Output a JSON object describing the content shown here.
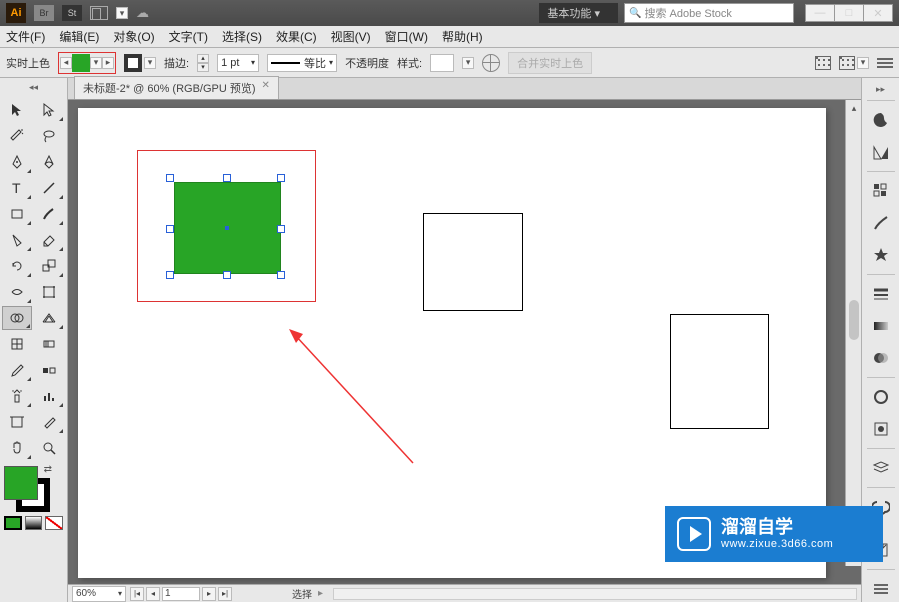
{
  "titlebar": {
    "workspace_label": "基本功能",
    "search_placeholder": "搜索 Adobe Stock"
  },
  "menu": {
    "file": "文件(F)",
    "edit": "编辑(E)",
    "object": "对象(O)",
    "text": "文字(T)",
    "select": "选择(S)",
    "effect": "效果(C)",
    "view": "视图(V)",
    "window": "窗口(W)",
    "help": "帮助(H)"
  },
  "options": {
    "label": "实时上色",
    "stroke_label": "描边:",
    "stroke_width": "1 pt",
    "proportional": "等比",
    "opacity_label": "不透明度",
    "style_label": "样式:",
    "merge_btn": "合并实时上色"
  },
  "doc": {
    "tab_title": "未标题-2* @ 60% (RGB/GPU 预览)"
  },
  "status": {
    "zoom": "60%",
    "page": "1",
    "mode_label": "选择"
  },
  "watermark": {
    "title": "溜溜自学",
    "url": "www.zixue.3d66.com"
  },
  "colors": {
    "fill": "#28a526",
    "selection_border": "#d33333"
  }
}
